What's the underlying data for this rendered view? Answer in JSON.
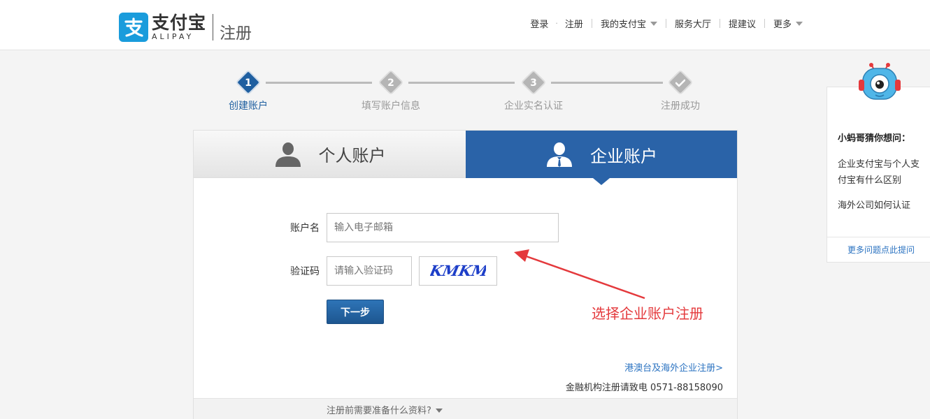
{
  "header": {
    "logo_cn": "支付宝",
    "logo_en": "ALIPAY",
    "page_title": "注册",
    "nav": {
      "login": "登录",
      "register": "注册",
      "my_alipay": "我的支付宝",
      "service_hall": "服务大厅",
      "suggest": "提建议",
      "more": "更多"
    }
  },
  "steps": [
    {
      "num": "1",
      "label": "创建账户"
    },
    {
      "num": "2",
      "label": "填写账户信息"
    },
    {
      "num": "3",
      "label": "企业实名认证"
    },
    {
      "num": "",
      "label": "注册成功"
    }
  ],
  "tabs": {
    "personal": "个人账户",
    "enterprise": "企业账户"
  },
  "form": {
    "account_label": "账户名",
    "account_placeholder": "输入电子邮箱",
    "captcha_label": "验证码",
    "captcha_placeholder": "请输入验证码",
    "captcha_text": "KMKM",
    "next_button": "下一步"
  },
  "annotation": "选择企业账户注册",
  "links": {
    "overseas": "港澳台及海外企业注册>",
    "hotline": "金融机构注册请致电 0571-88158090",
    "prepare": "注册前需要准备什么资料?"
  },
  "side": {
    "title": "小蚂哥猜你想问：",
    "q1": "企业支付宝与个人支付宝有什么区别",
    "q2": "海外公司如何认证",
    "more_link": "更多问题点此提问"
  },
  "colors": {
    "brand_blue": "#2a63a8",
    "logo_blue": "#1a9cdc",
    "link_blue": "#2b73c1",
    "annotation_red": "#e4393c"
  }
}
